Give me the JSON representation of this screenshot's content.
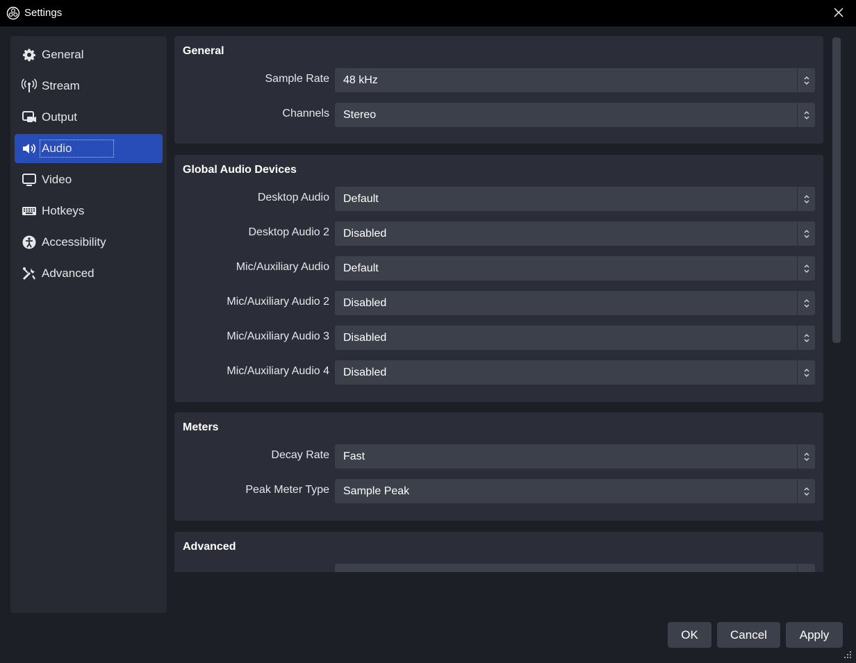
{
  "window": {
    "title": "Settings",
    "app_icon": "obs-logo-icon",
    "close_icon": "close-icon"
  },
  "sidebar": {
    "items": [
      {
        "label": "General",
        "icon": "gear-icon"
      },
      {
        "label": "Stream",
        "icon": "antenna-icon"
      },
      {
        "label": "Output",
        "icon": "output-icon"
      },
      {
        "label": "Audio",
        "icon": "speaker-icon",
        "active": true
      },
      {
        "label": "Video",
        "icon": "monitor-icon"
      },
      {
        "label": "Hotkeys",
        "icon": "keyboard-icon"
      },
      {
        "label": "Accessibility",
        "icon": "accessibility-icon"
      },
      {
        "label": "Advanced",
        "icon": "tools-icon"
      }
    ]
  },
  "groups": {
    "general": {
      "title": "General",
      "rows": [
        {
          "label": "Sample Rate",
          "value": "48 kHz"
        },
        {
          "label": "Channels",
          "value": "Stereo"
        }
      ]
    },
    "devices": {
      "title": "Global Audio Devices",
      "rows": [
        {
          "label": "Desktop Audio",
          "value": "Default"
        },
        {
          "label": "Desktop Audio 2",
          "value": "Disabled"
        },
        {
          "label": "Mic/Auxiliary Audio",
          "value": "Default"
        },
        {
          "label": "Mic/Auxiliary Audio 2",
          "value": "Disabled"
        },
        {
          "label": "Mic/Auxiliary Audio 3",
          "value": "Disabled"
        },
        {
          "label": "Mic/Auxiliary Audio 4",
          "value": "Disabled"
        }
      ]
    },
    "meters": {
      "title": "Meters",
      "rows": [
        {
          "label": "Decay Rate",
          "value": "Fast"
        },
        {
          "label": "Peak Meter Type",
          "value": "Sample Peak"
        }
      ]
    },
    "advanced": {
      "title": "Advanced"
    }
  },
  "buttons": {
    "ok": "OK",
    "cancel": "Cancel",
    "apply": "Apply"
  },
  "colors": {
    "active": "#284cb8",
    "panel": "#2b2e38",
    "combo": "#3c404b",
    "background": "#1d1f26"
  }
}
